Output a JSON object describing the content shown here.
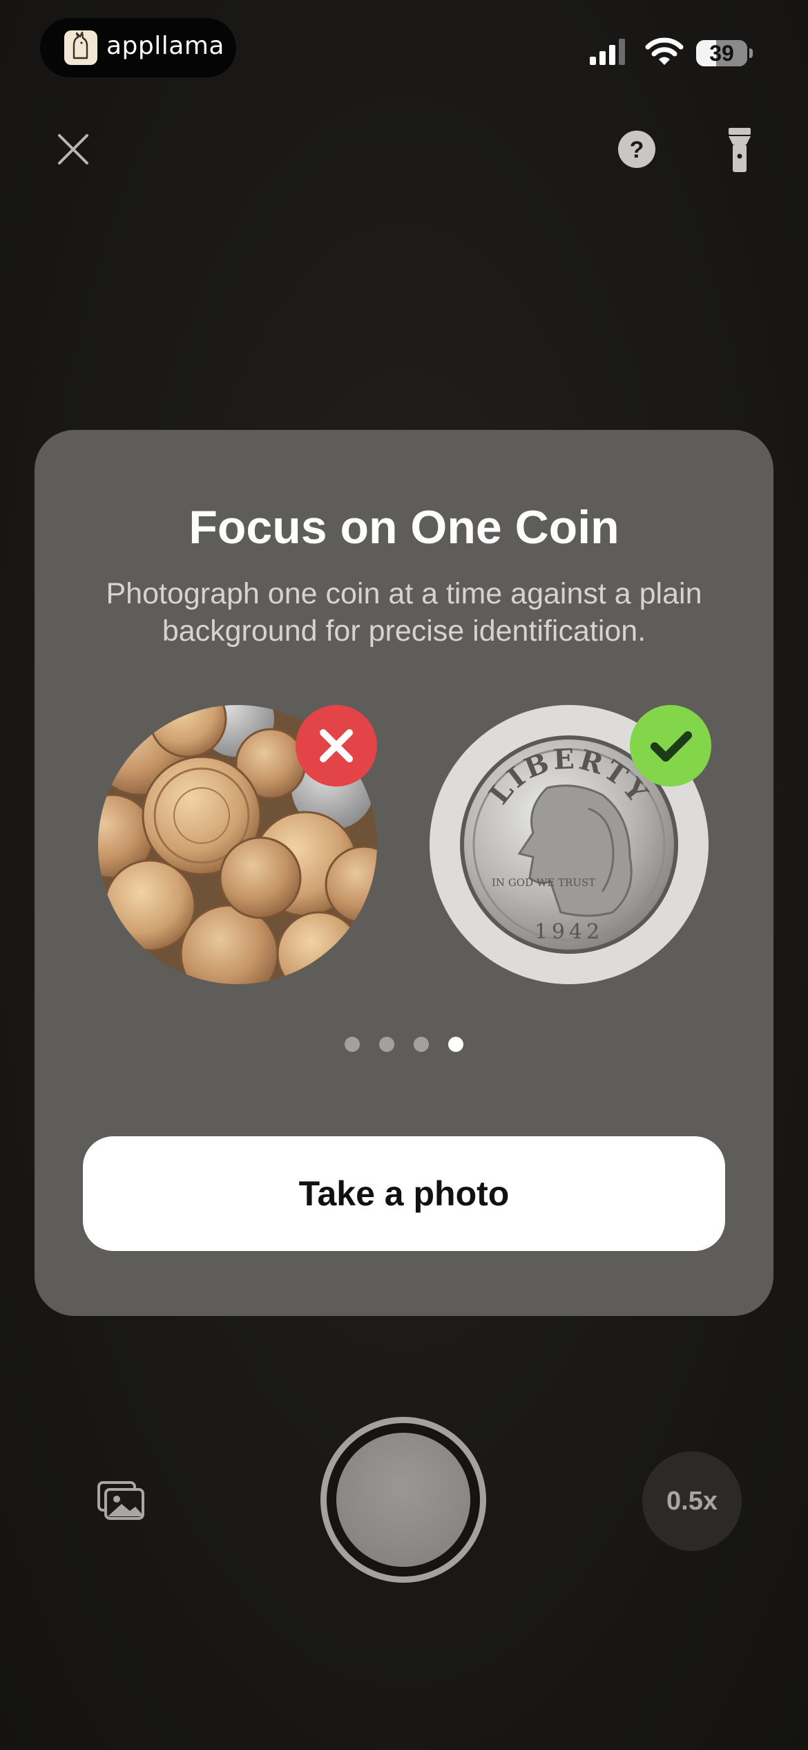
{
  "status_bar": {
    "app_pill_name": "appllama",
    "battery_level": "39",
    "battery_fraction": 0.39
  },
  "top_controls": {
    "close_icon": "close-icon",
    "help_icon": "help-icon",
    "flashlight_icon": "flashlight-icon"
  },
  "tip_card": {
    "title": "Focus on One Coin",
    "description": "Photograph one coin at a time against a plain background for precise identification.",
    "bad_example_icon": "x-mark-icon",
    "good_example_icon": "checkmark-icon",
    "good_coin_inscriptions": {
      "liberty": "LIBERTY",
      "motto": "IN GOD WE TRUST",
      "year": "1942"
    },
    "pagination": {
      "total": 4,
      "active_index": 3
    },
    "primary_button_label": "Take a photo"
  },
  "camera_controls": {
    "gallery_icon": "photo-gallery-icon",
    "shutter_icon": "shutter-button",
    "zoom_label": "0.5x"
  },
  "colors": {
    "card_background": "#5f5d59",
    "error_badge": "#e24447",
    "success_badge": "#83d64a",
    "page_background": "#1b1a18"
  }
}
